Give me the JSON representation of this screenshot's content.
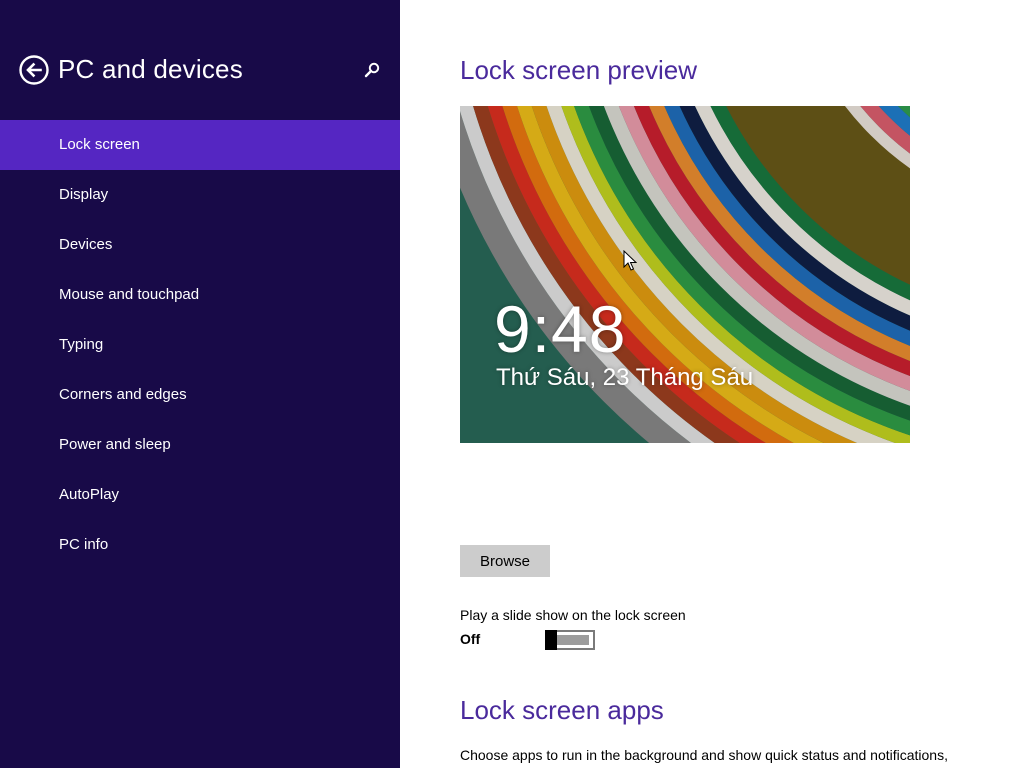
{
  "sidebar": {
    "title": "PC and devices",
    "back_icon": "back-arrow-icon",
    "search_icon": "search-icon",
    "background_color": "#180a48",
    "selected_color": "#5526c2",
    "items": [
      {
        "label": "Lock screen",
        "selected": true
      },
      {
        "label": "Display",
        "selected": false
      },
      {
        "label": "Devices",
        "selected": false
      },
      {
        "label": "Mouse and touchpad",
        "selected": false
      },
      {
        "label": "Typing",
        "selected": false
      },
      {
        "label": "Corners and edges",
        "selected": false
      },
      {
        "label": "Power and sleep",
        "selected": false
      },
      {
        "label": "AutoPlay",
        "selected": false
      },
      {
        "label": "PC info",
        "selected": false
      }
    ]
  },
  "main": {
    "accent_color": "#4a2a9c",
    "preview_section": {
      "title": "Lock screen preview",
      "time": "9:48",
      "date": "Thứ Sáu, 23 Tháng Sáu"
    },
    "browse_label": "Browse",
    "slideshow": {
      "label": "Play a slide show on the lock screen",
      "state": "Off",
      "on": false
    },
    "apps_section": {
      "title": "Lock screen apps",
      "description": "Choose apps to run in the background and show quick status and notifications,"
    }
  }
}
